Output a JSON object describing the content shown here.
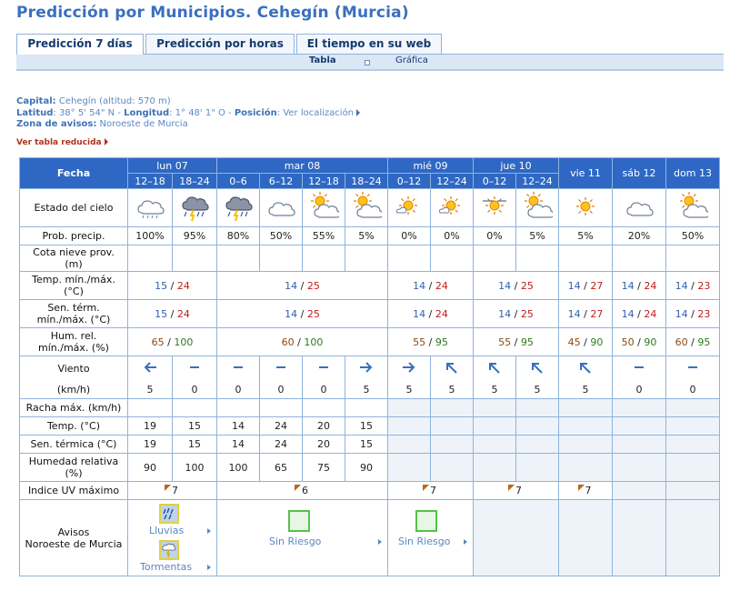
{
  "title": "Predicción por Municipios. Cehegín (Murcia)",
  "tabs": [
    {
      "label": "Predicción 7 días",
      "active": true
    },
    {
      "label": "Predicción por horas",
      "active": false
    },
    {
      "label": "El tiempo en su web",
      "active": false
    }
  ],
  "subnav": {
    "tabla": "Tabla",
    "grafica": "Gráfica"
  },
  "info": {
    "capital_label": "Capital:",
    "capital_value": "Cehegín (altitud: 570 m)",
    "lat_label": "Latitud",
    "lat_value": ": 38° 5' 54\" N -",
    "lon_label": "Longitud",
    "lon_value": ": 1° 48' 1\" O -",
    "pos_label": "Posición",
    "pos_value": ": Ver localización",
    "zona_label": "Zona de avisos:",
    "zona_value": "Noroeste de Murcia"
  },
  "reduced_link": "Ver tabla reducida",
  "table": {
    "fecha": "Fecha",
    "days": [
      "lun 07",
      "mar 08",
      "mié 09",
      "jue 10",
      "vie 11",
      "sáb 12",
      "dom 13"
    ],
    "periods": [
      "12–18",
      "18–24",
      "0–6",
      "6–12",
      "12–18",
      "18–24",
      "0–12",
      "12–24",
      "0–12",
      "12–24"
    ],
    "labels": {
      "estado": "Estado del cielo",
      "prob": "Prob. precip.",
      "cota_1": "Cota nieve prov.",
      "cota_2": "(m)",
      "temp_1": "Temp. mín./máx.",
      "temp_2": "(°C)",
      "sen_1": "Sen. térm.",
      "sen_2": "mín./máx. (°C)",
      "hum_1": "Hum. rel.",
      "hum_2": "mín./máx. (%)",
      "viento": "Viento",
      "kmh": "(km/h)",
      "racha": "Racha máx. (km/h)",
      "temp_h": "Temp. (°C)",
      "sen_h": "Sen. térmica (°C)",
      "hum_h_1": "Humedad relativa",
      "hum_h_2": "(%)",
      "uv": "Indice UV máximo",
      "avisos_1": "Avisos",
      "avisos_2": "Noroeste de Murcia"
    },
    "sky_icons": [
      "rain-cloud-icon",
      "storm-rain-icon",
      "storm-rain-icon",
      "cloudy-icon",
      "partly-cloudy-icon",
      "partly-cloudy-icon",
      "sun-cloud-icon",
      "sun-cloud-icon",
      "sun-haze-icon",
      "partly-cloudy-icon",
      "sun-icon",
      "cloudy-icon",
      "partly-cloudy-icon"
    ],
    "prob": [
      "100%",
      "95%",
      "80%",
      "50%",
      "55%",
      "5%",
      "0%",
      "0%",
      "0%",
      "5%",
      "5%",
      "20%",
      "50%"
    ],
    "temp": [
      {
        "min": "15",
        "max": "24"
      },
      {
        "min": "14",
        "max": "25"
      },
      {
        "min": "14",
        "max": "24"
      },
      {
        "min": "14",
        "max": "25"
      },
      {
        "min": "14",
        "max": "27"
      },
      {
        "min": "14",
        "max": "24"
      },
      {
        "min": "14",
        "max": "23"
      }
    ],
    "sen": [
      {
        "min": "15",
        "max": "24"
      },
      {
        "min": "14",
        "max": "25"
      },
      {
        "min": "14",
        "max": "24"
      },
      {
        "min": "14",
        "max": "25"
      },
      {
        "min": "14",
        "max": "27"
      },
      {
        "min": "14",
        "max": "24"
      },
      {
        "min": "14",
        "max": "23"
      }
    ],
    "hum": [
      {
        "min": "65",
        "max": "100"
      },
      {
        "min": "60",
        "max": "100"
      },
      {
        "min": "55",
        "max": "95"
      },
      {
        "min": "55",
        "max": "95"
      },
      {
        "min": "45",
        "max": "90"
      },
      {
        "min": "50",
        "max": "90"
      },
      {
        "min": "60",
        "max": "95"
      }
    ],
    "wind_icons": [
      "arrow-west-icon",
      "calm-icon",
      "calm-icon",
      "calm-icon",
      "calm-icon",
      "arrow-east-icon",
      "arrow-east-icon",
      "arrow-northwest-icon",
      "arrow-northwest-icon",
      "arrow-northwest-icon",
      "arrow-northwest-icon",
      "calm-icon",
      "calm-icon"
    ],
    "wind_kmh": [
      "5",
      "0",
      "0",
      "0",
      "0",
      "5",
      "5",
      "5",
      "5",
      "5",
      "5",
      "0",
      "0"
    ],
    "temp_h": [
      "19",
      "15",
      "14",
      "24",
      "20",
      "15"
    ],
    "sen_h": [
      "19",
      "15",
      "14",
      "24",
      "20",
      "15"
    ],
    "hum_h": [
      "90",
      "100",
      "100",
      "65",
      "75",
      "90"
    ],
    "uv": [
      "7",
      "6",
      "7",
      "7",
      "7"
    ],
    "avisos": {
      "lluvias": "Lluvias",
      "tormentas": "Tormentas",
      "sin_riesgo_1": "Sin Riesgo",
      "sin_riesgo_2": "Sin Riesgo"
    }
  }
}
